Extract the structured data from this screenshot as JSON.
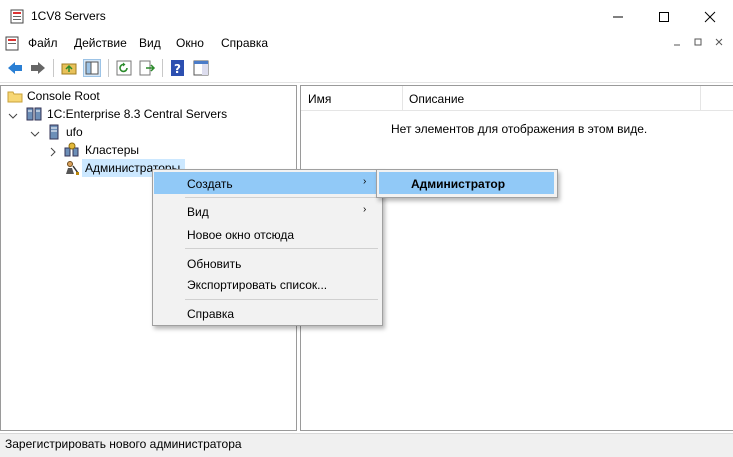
{
  "window": {
    "title": "1CV8 Servers"
  },
  "menu": [
    "Файл",
    "Действие",
    "Вид",
    "Окно",
    "Справка"
  ],
  "tree": {
    "root": "Console Root",
    "server_group": "1C:Enterprise 8.3 Central Servers",
    "server": "ufo",
    "clusters": "Кластеры",
    "admins": "Администраторы"
  },
  "list": {
    "columns": [
      "Имя",
      "Описание"
    ],
    "empty_message": "Нет элементов для отображения в этом виде."
  },
  "context_menu": {
    "items": [
      "Создать",
      "Вид",
      "Новое окно отсюда",
      "Обновить",
      "Экспортировать список...",
      "Справка"
    ],
    "arrow": "›"
  },
  "submenu": {
    "item": "Администратор"
  },
  "status": {
    "text": "Зарегистрировать нового администратора"
  },
  "colors": {
    "highlight": "#91c9f7",
    "selection": "#cce8ff"
  }
}
